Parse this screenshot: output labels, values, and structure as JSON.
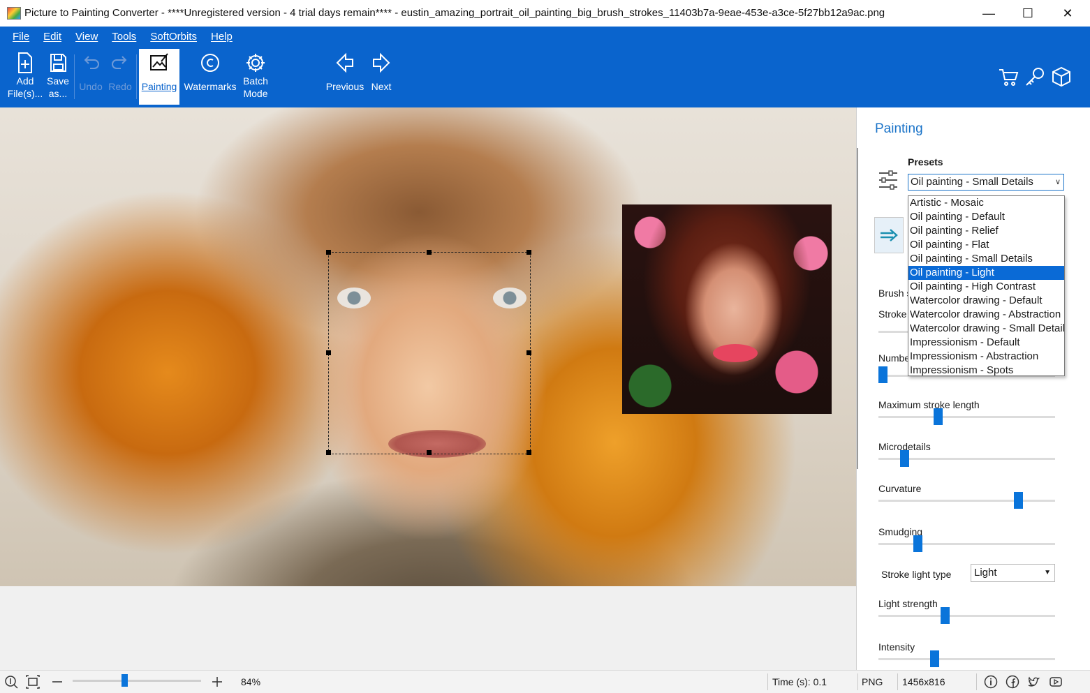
{
  "window": {
    "title": "Picture to Painting Converter - ****Unregistered version - 4 trial days remain**** - eustin_amazing_portrait_oil_painting_big_brush_strokes_11403b7a-9eae-453e-a3ce-5f27bb12a9ac.png",
    "minimize": "—",
    "maximize": "☐",
    "close": "✕"
  },
  "menu": [
    "File",
    "Edit",
    "View",
    "Tools",
    "SoftOrbits",
    "Help"
  ],
  "toolbar": {
    "add_files": [
      "Add",
      "File(s)..."
    ],
    "save_as": [
      "Save",
      "as..."
    ],
    "undo": "Undo",
    "redo": "Redo",
    "painting": "Painting",
    "watermarks": "Watermarks",
    "batch_mode": [
      "Batch",
      "Mode"
    ],
    "previous": "Previous",
    "next": "Next"
  },
  "panel": {
    "title": "Painting",
    "presets_label": "Presets",
    "preset_selected": "Oil painting - Small Details",
    "preset_options": [
      "Artistic - Mosaic",
      "Oil painting - Default",
      "Oil painting - Relief",
      "Oil painting - Flat",
      "Oil painting - Small Details",
      "Oil painting - Light",
      "Oil painting - High Contrast",
      "Watercolor drawing - Default",
      "Watercolor drawing - Abstraction",
      "Watercolor drawing - Small Details",
      "Impressionism - Default",
      "Impressionism - Abstraction",
      "Impressionism - Spots"
    ],
    "highlighted_option": "Oil painting - Light",
    "hidden_labels": {
      "brush": "Brush size",
      "stroke": "Stroke",
      "number": "Number of strokes"
    },
    "params": [
      {
        "label": "Maximum stroke length",
        "value": 0.33
      },
      {
        "label": "Microdetails",
        "value": 0.13
      },
      {
        "label": "Curvature",
        "value": 0.81
      },
      {
        "label": "Smudging",
        "value": 0.21
      },
      {
        "label": "Light strength",
        "value": 0.37
      },
      {
        "label": "Intensity",
        "value": 0.31
      }
    ],
    "number_value": 0.0,
    "stroke_light_type_label": "Stroke light type",
    "stroke_light_type_value": "Light"
  },
  "status": {
    "zoom": "84%",
    "zoom_level": 0.4,
    "time": "Time (s): 0.1",
    "format": "PNG",
    "dimensions": "1456x816"
  },
  "colors": {
    "ribbon": "#0a64cd",
    "accent": "#0a74da",
    "selection_highlight": "#0a6ad6"
  }
}
